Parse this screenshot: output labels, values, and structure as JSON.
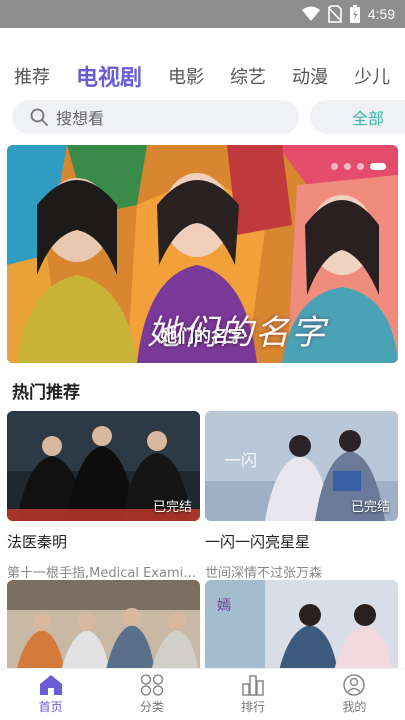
{
  "status_bar": {
    "time": "4:59"
  },
  "tabs": [
    {
      "label": "推荐"
    },
    {
      "label": "电视剧",
      "active": true
    },
    {
      "label": "电影"
    },
    {
      "label": "综艺"
    },
    {
      "label": "动漫"
    },
    {
      "label": "少儿"
    }
  ],
  "search": {
    "placeholder": "搜想看",
    "all_label": "全部"
  },
  "banner": {
    "title": "她们的名字",
    "caption": "她们的名字",
    "dots": 4,
    "active_dot": 3
  },
  "section": {
    "title": "热门推荐"
  },
  "cards": [
    {
      "title": "法医秦明",
      "subtitle": "第十一根手指,Medical Exami…",
      "badge": "已完结"
    },
    {
      "title": "一闪一闪亮星星",
      "subtitle": "世间深情不过张万森",
      "badge": "已完结"
    },
    {
      "title": "",
      "subtitle": "",
      "badge": ""
    },
    {
      "title": "",
      "subtitle": "",
      "badge": ""
    }
  ],
  "bottom_nav": [
    {
      "label": "首页",
      "icon": "home-icon",
      "active": true
    },
    {
      "label": "分类",
      "icon": "grid-icon"
    },
    {
      "label": "排行",
      "icon": "chart-icon"
    },
    {
      "label": "我的",
      "icon": "user-icon"
    }
  ],
  "colors": {
    "accent": "#6b5bd6",
    "teal": "#3cb8a8",
    "status_bar": "#8e8e8e"
  }
}
